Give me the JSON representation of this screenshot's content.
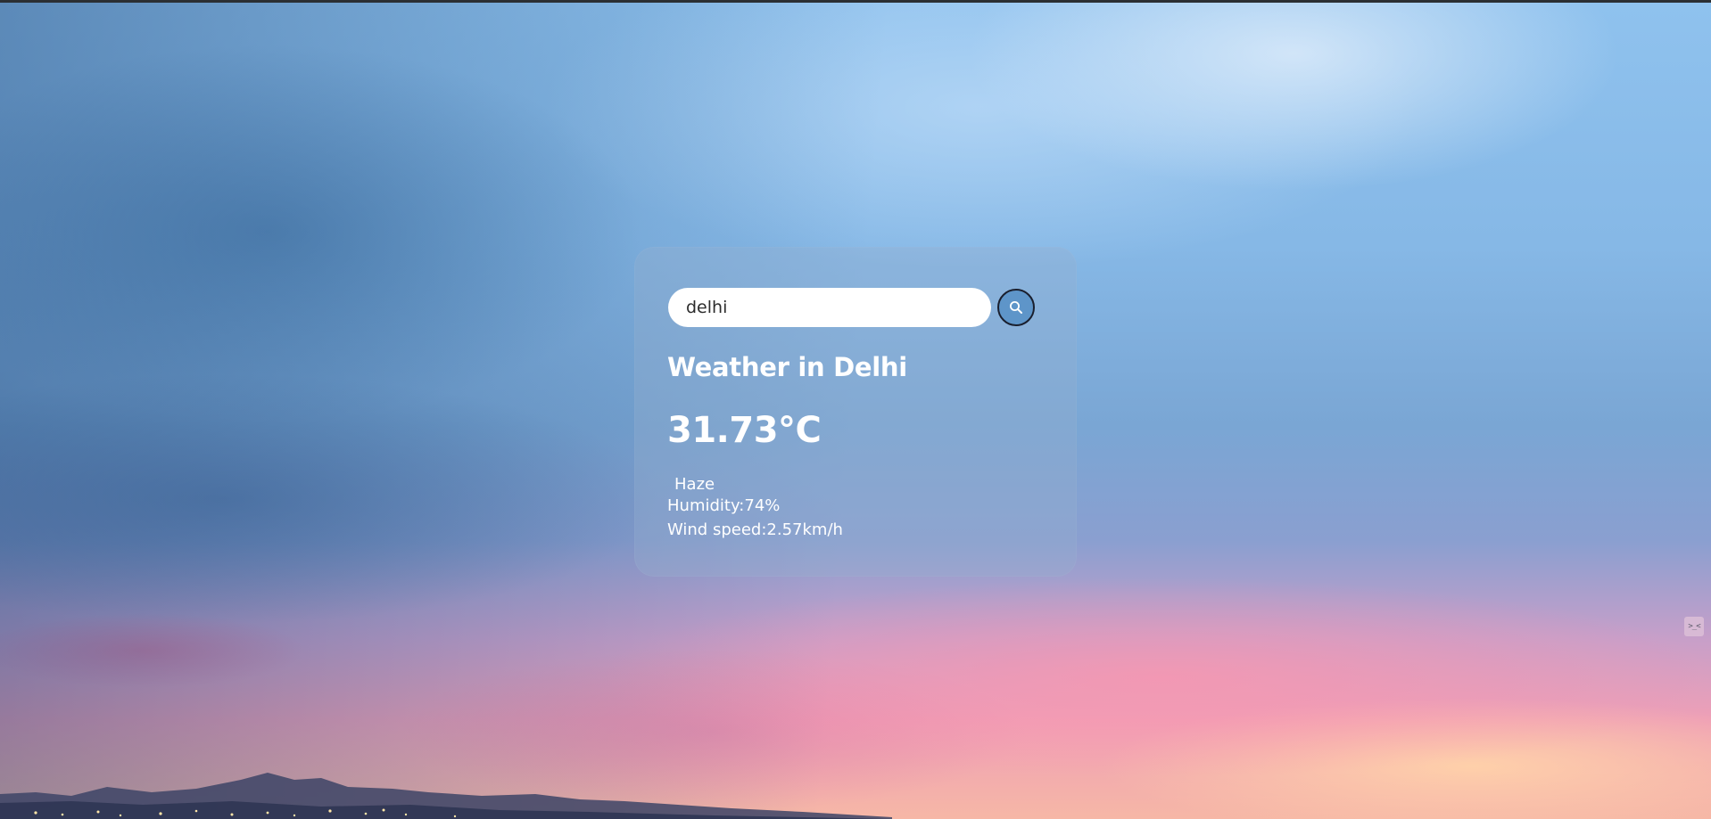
{
  "search": {
    "value": "delhi",
    "button_icon": "search-icon"
  },
  "weather": {
    "title": "Weather in Delhi",
    "temperature": "31.73°C",
    "description": "Haze",
    "humidity": "Humidity:74%",
    "wind": "Wind speed:2.57km/h"
  },
  "extension": {
    "icon_text": ">_<"
  },
  "colors": {
    "card_background": "#96afcd",
    "search_button": "#5e95c9",
    "text": "#ffffff"
  }
}
